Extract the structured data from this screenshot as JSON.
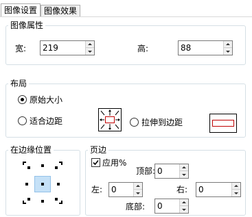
{
  "tabs": [
    {
      "label": "图像设置",
      "active": true
    },
    {
      "label": "图像效果",
      "active": false
    }
  ],
  "image_props": {
    "title": "图像属性",
    "width_label": "宽:",
    "width_value": "219",
    "height_label": "高:",
    "height_value": "88"
  },
  "layout": {
    "title": "布局",
    "original_size_label": "原始大小",
    "fit_margin_label": "适合边距",
    "stretch_label": "拉伸到边距",
    "selected": "原始大小"
  },
  "edge_position": {
    "title": "在边缘位置",
    "selected": "center"
  },
  "margins": {
    "title": "页边",
    "apply_percent_label": "应用%",
    "apply_percent_checked": true,
    "top_label": "顶部:",
    "top_value": "0",
    "left_label": "左:",
    "left_value": "0",
    "right_label": "右:",
    "right_value": "0",
    "bottom_label": "底部:",
    "bottom_value": "0"
  },
  "colors": {
    "accent_red": "#c00000",
    "selection_blue": "#c5e1f7",
    "group_border": "#d5dfe5"
  }
}
